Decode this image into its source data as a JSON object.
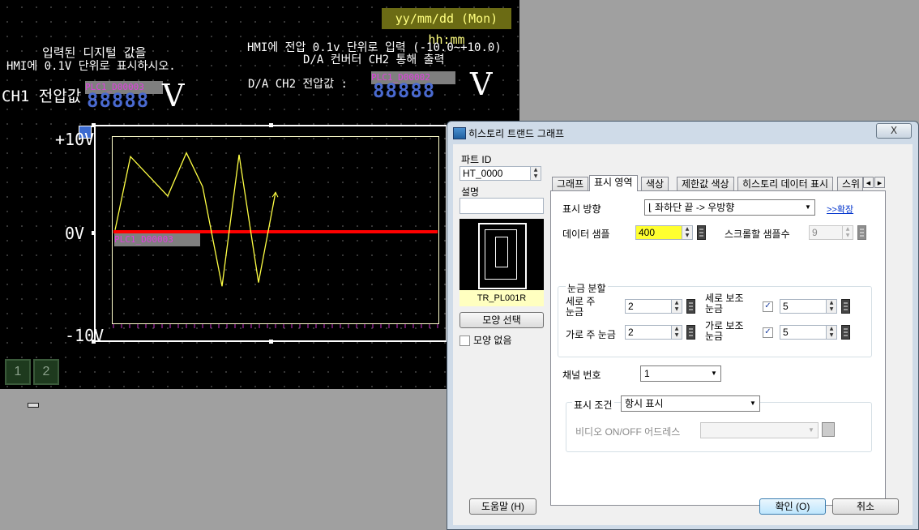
{
  "hmi": {
    "clock": "yy/mm/dd (Mon) hh:mm",
    "left_note_line1": "입력된 디지털 값을",
    "left_note_line2": "HMI에 0.1V 단위로 표시하시오.",
    "right_note_line1": "HMI에 전압 0.1v 단위로 입력 (-10.0~+10.0)",
    "right_note_line2": "D/A 컨버터 CH2 통해 출력",
    "ch1_label": "CH1 전압값 :",
    "ch1_address": "PLC1_D00003",
    "ch1_digits": "88888",
    "ch1_unit": "V",
    "da_label": "D/A CH2 전압값 :",
    "da_address": "PLC1_D00002",
    "da_digits": "88888",
    "da_unit": "V",
    "axis_top": "+10V",
    "axis_mid": "0V",
    "axis_bottom": "-10V",
    "trend_address": "PLC1_D00003",
    "page_buttons": [
      "1",
      "2"
    ],
    "trend_points": [
      0.02,
      0.8,
      0.38,
      0.84,
      0.48,
      -0.58,
      0.82,
      -0.54,
      0.42
    ],
    "colors": {
      "trend": "#ffff44",
      "zero_line": "#ff0000",
      "ticks": "#cc33cc"
    }
  },
  "dialog": {
    "title": "히스토리 트랜드 그래프",
    "close_label": "X",
    "part_id_label": "파트 ID",
    "part_id_value": "HT_0000",
    "desc_label": "설명",
    "desc_value": "",
    "preview_caption": "TR_PL001R",
    "shape_select_label": "모양 선택",
    "no_shape_label": "모양 없음",
    "tabs": [
      "그래프",
      "표시 영역",
      "색상",
      "제한값 색상",
      "히스토리 데이터 표시",
      "스위"
    ],
    "active_tab": "표시 영역",
    "display_direction_label": "표시 방향",
    "display_direction_value": "좌하단 끝 -> 우방향",
    "expand_link": ">>확장",
    "data_samples_label": "데이터 샘플",
    "data_samples_value": "400",
    "scroll_samples_label": "스크롤할 샘플수",
    "scroll_samples_value": "9",
    "scale_group_label": "눈금 분할",
    "vertical_major_label": "세로 주 눈금",
    "vertical_major_value": "2",
    "vertical_minor_label": "세로 보조 눈금",
    "vertical_minor_value": "5",
    "horizontal_major_label": "가로 주 눈금",
    "horizontal_major_value": "2",
    "horizontal_minor_label": "가로 보조 눈금",
    "horizontal_minor_value": "5",
    "channel_label": "채널 번호",
    "channel_value": "1",
    "display_condition_label": "표시 조건",
    "display_condition_value": "항시 표시",
    "video_address_label": "비디오 ON/OFF 어드레스",
    "video_address_value": "",
    "help_button": "도움말 (H)",
    "ok_button": "확인 (O)",
    "cancel_button": "취소"
  }
}
